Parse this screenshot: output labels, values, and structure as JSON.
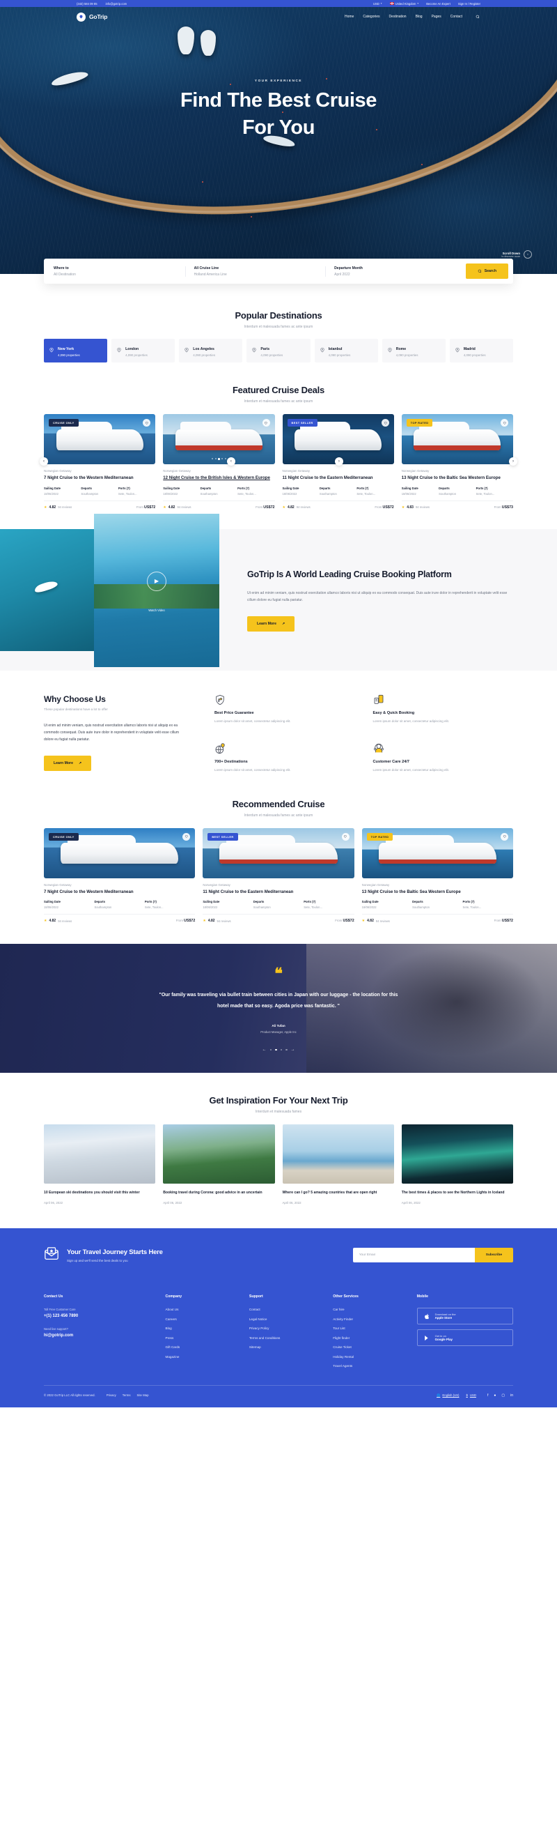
{
  "topbar": {
    "phone": "(343) 584 09 85",
    "email": "info@gotrip.com",
    "currency": "USD",
    "country": "United Kingdom",
    "become_expert": "Become An Expert",
    "signin": "Sign In / Register"
  },
  "header": {
    "logo": "GoTrip",
    "nav": [
      "Home",
      "Categories",
      "Destination",
      "Blog",
      "Pages",
      "Contact"
    ],
    "search_icon": "search-icon"
  },
  "hero": {
    "eyebrow": "YOUR EXPERIENCE",
    "title_line1": "Find The Best Cruise",
    "title_line2": "For You",
    "scroll_title": "Scroll Down",
    "scroll_sub": "to discover more"
  },
  "searchbar": {
    "fields": [
      {
        "label": "Where to",
        "value": "All Destination"
      },
      {
        "label": "All Cruise Line",
        "value": "Holland America Line"
      },
      {
        "label": "Departure Month",
        "value": "April 2022"
      }
    ],
    "button": "Search"
  },
  "destinations": {
    "title": "Popular Destinations",
    "subtitle": "Interdum et malesuada fames ac ante ipsum",
    "items": [
      {
        "name": "New York",
        "properties": "4,090 properties",
        "active": true
      },
      {
        "name": "London",
        "properties": "4,090 properties",
        "active": false
      },
      {
        "name": "Los Angeles",
        "properties": "4,090 properties",
        "active": false
      },
      {
        "name": "Paris",
        "properties": "4,090 properties",
        "active": false
      },
      {
        "name": "Istanbul",
        "properties": "4,090 properties",
        "active": false
      },
      {
        "name": "Rome",
        "properties": "4,090 properties",
        "active": false
      },
      {
        "name": "Madrid",
        "properties": "4,090 properties",
        "active": false
      }
    ]
  },
  "featured": {
    "title": "Featured Cruise Deals",
    "subtitle": "Interdum et malesuada fames ac ante ipsum",
    "meta_labels": {
      "sailing": "Sailing Date",
      "departs": "Departs",
      "ports": "Ports (7)"
    },
    "from_label": "From",
    "cards": [
      {
        "badge": "CRUISE ONLY",
        "badge_type": "cruise-only",
        "brand": "Norwegian Getaway",
        "title": "7 Night Cruise to the Western Mediterranean",
        "sailing_date": "18/06/2022",
        "departs": "Southampton",
        "ports": "Sete, Toulon...",
        "score": "4.82",
        "reviews": "94 reviews",
        "price": "US$72"
      },
      {
        "badge": "",
        "badge_type": "none",
        "brand": "Norwegian Getaway",
        "title": "12 Night Cruise to the British Isles & Western Europe",
        "sailing_date": "18/06/2022",
        "departs": "Southampton",
        "ports": "Sete, Toulon...",
        "score": "4.82",
        "reviews": "94 reviews",
        "price": "US$72"
      },
      {
        "badge": "BEST SELLER",
        "badge_type": "best-seller",
        "brand": "Norwegian Getaway",
        "title": "11 Night Cruise to the Eastern Mediterranean",
        "sailing_date": "18/06/2022",
        "departs": "Southampton",
        "ports": "Sete, Toulon...",
        "score": "4.82",
        "reviews": "94 reviews",
        "price": "US$72"
      },
      {
        "badge": "TOP RATED",
        "badge_type": "top-rated",
        "brand": "Norwegian Getaway",
        "title": "13 Night Cruise to the Baltic Sea Western Europe",
        "sailing_date": "18/06/2022",
        "departs": "Southampton",
        "ports": "Sete, Toulon...",
        "score": "4.83",
        "reviews": "94 reviews",
        "price": "US$73"
      }
    ]
  },
  "platform": {
    "title": "GoTrip Is A World Leading Cruise Booking Platform",
    "paragraph": "Ut enim ad minim veniam, quis nostrud exercitation ullamco laboris nisi ut aliquip ex ea commodo consequat. Duis aute irure dolor in reprehenderit in voluptate velit esse cillum dolore eu fugiat nulla pariatur.",
    "button": "Learn More",
    "play_label": "Watch Video"
  },
  "why": {
    "title": "Why Choose Us",
    "subtitle": "These popular destinations have a lot to offer",
    "paragraph": "Ut enim ad minim veniam, quis nostrud exercitation ullamco laboris nisi ut aliquip ex ea commodo consequat. Duis aute irure dolor in reprehenderit in voluptate velit esse cillum dolore eu fugiat nulla pariatur.",
    "button": "Learn More",
    "features": [
      {
        "icon": "shield-thumb-icon",
        "title": "Best Price Guarantee",
        "text": "Lorem ipsum dolor sit amet, consectetur adipiscing elit."
      },
      {
        "icon": "mobile-booking-icon",
        "title": "Easy & Quick Booking",
        "text": "Lorem ipsum dolor sit amet, consectetur adipiscing elit."
      },
      {
        "icon": "globe-pin-icon",
        "title": "700+ Destinations",
        "text": "Lorem ipsum dolor sit amet, consectetur adipiscing elit."
      },
      {
        "icon": "headset-agent-icon",
        "title": "Customer Care 24/7",
        "text": "Lorem ipsum dolor sit amet, consectetur adipiscing elit."
      }
    ]
  },
  "recommended": {
    "title": "Recommended Cruise",
    "subtitle": "Interdum et malesuada fames ac ante ipsum",
    "cards": [
      {
        "badge": "CRUISE ONLY",
        "badge_type": "cruise-only",
        "brand": "Norwegian Getaway",
        "title": "7 Night Cruise to the Western Mediterranean",
        "sailing_date": "18/06/2022",
        "departs": "Southampton",
        "ports": "Sete, Toulon...",
        "score": "4.82",
        "reviews": "94 reviews",
        "price": "US$72"
      },
      {
        "badge": "BEST SELLER",
        "badge_type": "best-seller",
        "brand": "Norwegian Getaway",
        "title": "11 Night Cruise to the Eastern Mediterranean",
        "sailing_date": "18/06/2022",
        "departs": "Southampton",
        "ports": "Sete, Toulon...",
        "score": "4.82",
        "reviews": "94 reviews",
        "price": "US$72"
      },
      {
        "badge": "TOP RATED",
        "badge_type": "top-rated",
        "brand": "Norwegian Getaway",
        "title": "13 Night Cruise to the Baltic Sea Western Europe",
        "sailing_date": "18/06/2022",
        "departs": "Southampton",
        "ports": "Sete, Toulon...",
        "score": "4.82",
        "reviews": "94 reviews",
        "price": "US$72"
      }
    ]
  },
  "testimonial": {
    "quote": "\"Our family was traveling via bullet train between cities in Japan with our luggage - the location for this hotel made that so easy. Agoda price was fantastic. \"",
    "name": "Ali Tufan",
    "role": "Product Manager, Apple Inc"
  },
  "blog": {
    "title": "Get Inspiration For Your Next Trip",
    "subtitle": "Interdum et malesuada fames",
    "posts": [
      {
        "title": "10 European ski destinations you should visit this winter",
        "date": "April 06, 2022"
      },
      {
        "title": "Booking travel during Corona: good advice in an uncertain",
        "date": "April 06, 2022"
      },
      {
        "title": "Where can I go? 5 amazing countries that are open right",
        "date": "April 06, 2022"
      },
      {
        "title": "The best times & places to see the Northern Lights in Iceland",
        "date": "April 06, 2022"
      }
    ]
  },
  "newsletter": {
    "title": "Your Travel Journey Starts Here",
    "subtitle": "Sign up and we'll send the best deals to you",
    "placeholder": "Your Email",
    "button": "Subscribe"
  },
  "footer": {
    "contact": {
      "heading": "Contact Us",
      "care_label": "Toll Free Customer Care",
      "phone": "+(1) 123 456 7890",
      "support_label": "Need live support?",
      "email": "hi@gotrip.com"
    },
    "company": {
      "heading": "Company",
      "links": [
        "About Us",
        "Careers",
        "Blog",
        "Press",
        "Gift Cards",
        "Magazine"
      ]
    },
    "support": {
      "heading": "Support",
      "links": [
        "Contact",
        "Legal Notice",
        "Privacy Policy",
        "Terms and Conditions",
        "Sitemap"
      ]
    },
    "other": {
      "heading": "Other Services",
      "links": [
        "Car hire",
        "Activity Finder",
        "Tour List",
        "Flight finder",
        "Cruise Ticket",
        "Holiday Rental",
        "Travel Agents"
      ]
    },
    "mobile": {
      "heading": "Mobile",
      "apple_line1": "Download on the",
      "apple_line2": "Apple Store",
      "google_line1": "Get in on",
      "google_line2": "Google Play"
    },
    "bottom": {
      "copyright": "© 2022 GoTrip LLC All rights reserved.",
      "links": [
        "Privacy",
        "Terms",
        "Site Map"
      ],
      "language": "English (US)",
      "currency": "USD",
      "social": [
        "facebook-icon",
        "twitter-icon",
        "instagram-icon",
        "linkedin-icon"
      ]
    }
  },
  "colors": {
    "brand": "#3554d1",
    "accent": "#f5c31c",
    "dark": "#161c2d"
  }
}
